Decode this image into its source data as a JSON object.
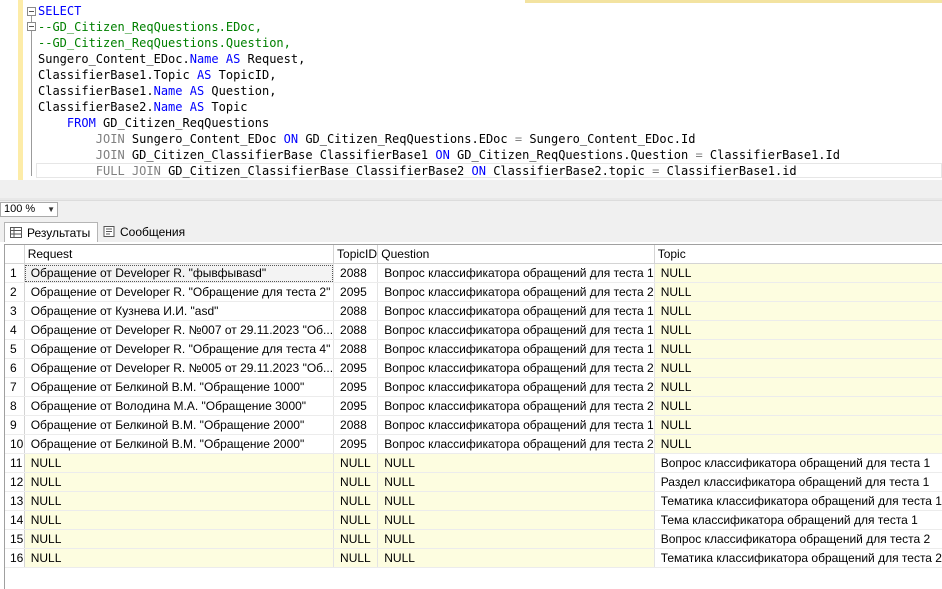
{
  "editor": {
    "lines": [
      [
        {
          "t": "SELECT",
          "c": "kw"
        }
      ],
      [
        {
          "t": "--GD_Citizen_ReqQuestions.EDoc,",
          "c": "cm"
        }
      ],
      [
        {
          "t": "--GD_Citizen_ReqQuestions.Question,",
          "c": "cm"
        }
      ],
      [
        {
          "t": "Sungero_Content_EDoc.",
          "c": ""
        },
        {
          "t": "Name",
          "c": "kw"
        },
        {
          "t": " ",
          "c": ""
        },
        {
          "t": "AS",
          "c": "kw"
        },
        {
          "t": " Request,",
          "c": ""
        }
      ],
      [
        {
          "t": "ClassifierBase1.Topic ",
          "c": ""
        },
        {
          "t": "AS",
          "c": "kw"
        },
        {
          "t": " TopicID,",
          "c": ""
        }
      ],
      [
        {
          "t": "ClassifierBase1.",
          "c": ""
        },
        {
          "t": "Name",
          "c": "kw"
        },
        {
          "t": " ",
          "c": ""
        },
        {
          "t": "AS",
          "c": "kw"
        },
        {
          "t": " Question,",
          "c": ""
        }
      ],
      [
        {
          "t": "ClassifierBase2.",
          "c": ""
        },
        {
          "t": "Name",
          "c": "kw"
        },
        {
          "t": " ",
          "c": ""
        },
        {
          "t": "AS",
          "c": "kw"
        },
        {
          "t": " Topic",
          "c": ""
        }
      ],
      [
        {
          "t": "    ",
          "c": ""
        },
        {
          "t": "FROM",
          "c": "kw"
        },
        {
          "t": " GD_Citizen_ReqQuestions",
          "c": ""
        }
      ],
      [
        {
          "t": "        ",
          "c": ""
        },
        {
          "t": "JOIN",
          "c": "gr"
        },
        {
          "t": " Sungero_Content_EDoc ",
          "c": ""
        },
        {
          "t": "ON",
          "c": "kw"
        },
        {
          "t": " GD_Citizen_ReqQuestions.EDoc ",
          "c": ""
        },
        {
          "t": "=",
          "c": "gr"
        },
        {
          "t": " Sungero_Content_EDoc.Id",
          "c": ""
        }
      ],
      [
        {
          "t": "        ",
          "c": ""
        },
        {
          "t": "JOIN",
          "c": "gr"
        },
        {
          "t": " GD_Citizen_ClassifierBase ClassifierBase1 ",
          "c": ""
        },
        {
          "t": "ON",
          "c": "kw"
        },
        {
          "t": " GD_Citizen_ReqQuestions.Question ",
          "c": ""
        },
        {
          "t": "=",
          "c": "gr"
        },
        {
          "t": " ClassifierBase1.Id",
          "c": ""
        }
      ],
      [
        {
          "t": "        ",
          "c": ""
        },
        {
          "t": "FULL",
          "c": "gr"
        },
        {
          "t": " ",
          "c": ""
        },
        {
          "t": "JOIN",
          "c": "gr"
        },
        {
          "t": " GD_Citizen_ClassifierBase ClassifierBase2 ",
          "c": ""
        },
        {
          "t": "ON",
          "c": "kw"
        },
        {
          "t": " ClassifierBase2.topic ",
          "c": ""
        },
        {
          "t": "=",
          "c": "gr"
        },
        {
          "t": " ClassifierBase1.id",
          "c": ""
        }
      ]
    ]
  },
  "zoom": {
    "value": "100 %"
  },
  "tabs": [
    {
      "label": "Результаты",
      "icon": "grid-icon"
    },
    {
      "label": "Сообщения",
      "icon": "messages-icon"
    }
  ],
  "grid": {
    "columns": [
      "Request",
      "TopicID",
      "Question",
      "Topic"
    ],
    "rows": [
      [
        "1",
        "Обращение от Developer R. \"фывфывasd\"",
        "2088",
        "Вопрос классификатора обращений для теста 1",
        "NULL"
      ],
      [
        "2",
        "Обращение от Developer R. \"Обращение для теста 2\"",
        "2095",
        "Вопрос классификатора обращений для теста 2",
        "NULL"
      ],
      [
        "3",
        "Обращение от Кузнева И.И. \"asd\"",
        "2088",
        "Вопрос классификатора обращений для теста 1",
        "NULL"
      ],
      [
        "4",
        "Обращение от Developer R. №007 от 29.11.2023 \"Об...",
        "2088",
        "Вопрос классификатора обращений для теста 1",
        "NULL"
      ],
      [
        "5",
        "Обращение от Developer R. \"Обращение для теста 4\"",
        "2088",
        "Вопрос классификатора обращений для теста 1",
        "NULL"
      ],
      [
        "6",
        "Обращение от Developer R. №005 от 29.11.2023 \"Об...",
        "2095",
        "Вопрос классификатора обращений для теста 2",
        "NULL"
      ],
      [
        "7",
        "Обращение от Белкиной В.М. \"Обращение 1000\"",
        "2095",
        "Вопрос классификатора обращений для теста 2",
        "NULL"
      ],
      [
        "8",
        "Обращение от Володина М.А. \"Обращение 3000\"",
        "2095",
        "Вопрос классификатора обращений для теста 2",
        "NULL"
      ],
      [
        "9",
        "Обращение от Белкиной В.М. \"Обращение 2000\"",
        "2088",
        "Вопрос классификатора обращений для теста 1",
        "NULL"
      ],
      [
        "10",
        "Обращение от Белкиной В.М. \"Обращение 2000\"",
        "2095",
        "Вопрос классификатора обращений для теста 2",
        "NULL"
      ],
      [
        "11",
        "NULL",
        "NULL",
        "NULL",
        "Вопрос классификатора обращений для теста 1"
      ],
      [
        "12",
        "NULL",
        "NULL",
        "NULL",
        "Раздел классификатора обращений для теста 1"
      ],
      [
        "13",
        "NULL",
        "NULL",
        "NULL",
        "Тематика классификатора обращений для теста 1"
      ],
      [
        "14",
        "NULL",
        "NULL",
        "NULL",
        "Тема классификатора обращений для теста 1"
      ],
      [
        "15",
        "NULL",
        "NULL",
        "NULL",
        "Вопрос классификатора обращений для теста 2"
      ],
      [
        "16",
        "NULL",
        "NULL",
        "NULL",
        "Тематика классификатора обращений для теста 2"
      ]
    ]
  }
}
